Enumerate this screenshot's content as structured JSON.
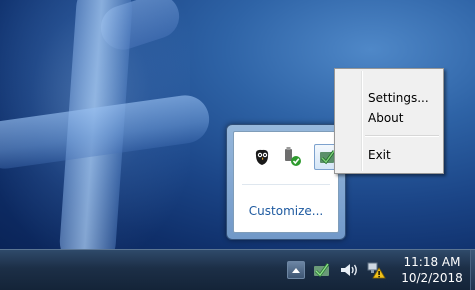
{
  "context_menu": {
    "items": [
      "Settings...",
      "About",
      "Exit"
    ]
  },
  "flyout": {
    "customize_label": "Customize...",
    "icons": [
      "owl-icon",
      "usb-safely-remove-icon",
      "app-checkmark-icon"
    ]
  },
  "taskbar": {
    "clock_time": "11:18 AM",
    "clock_date": "10/2/2018",
    "tray_icons": [
      "show-hidden-icons-arrow",
      "app-checkmark-icon",
      "volume-icon",
      "network-warning-icon"
    ]
  },
  "colors": {
    "link": "#1e5aa0",
    "taskbar": "#1c2f47",
    "menu_bg": "#f0f0f0"
  }
}
